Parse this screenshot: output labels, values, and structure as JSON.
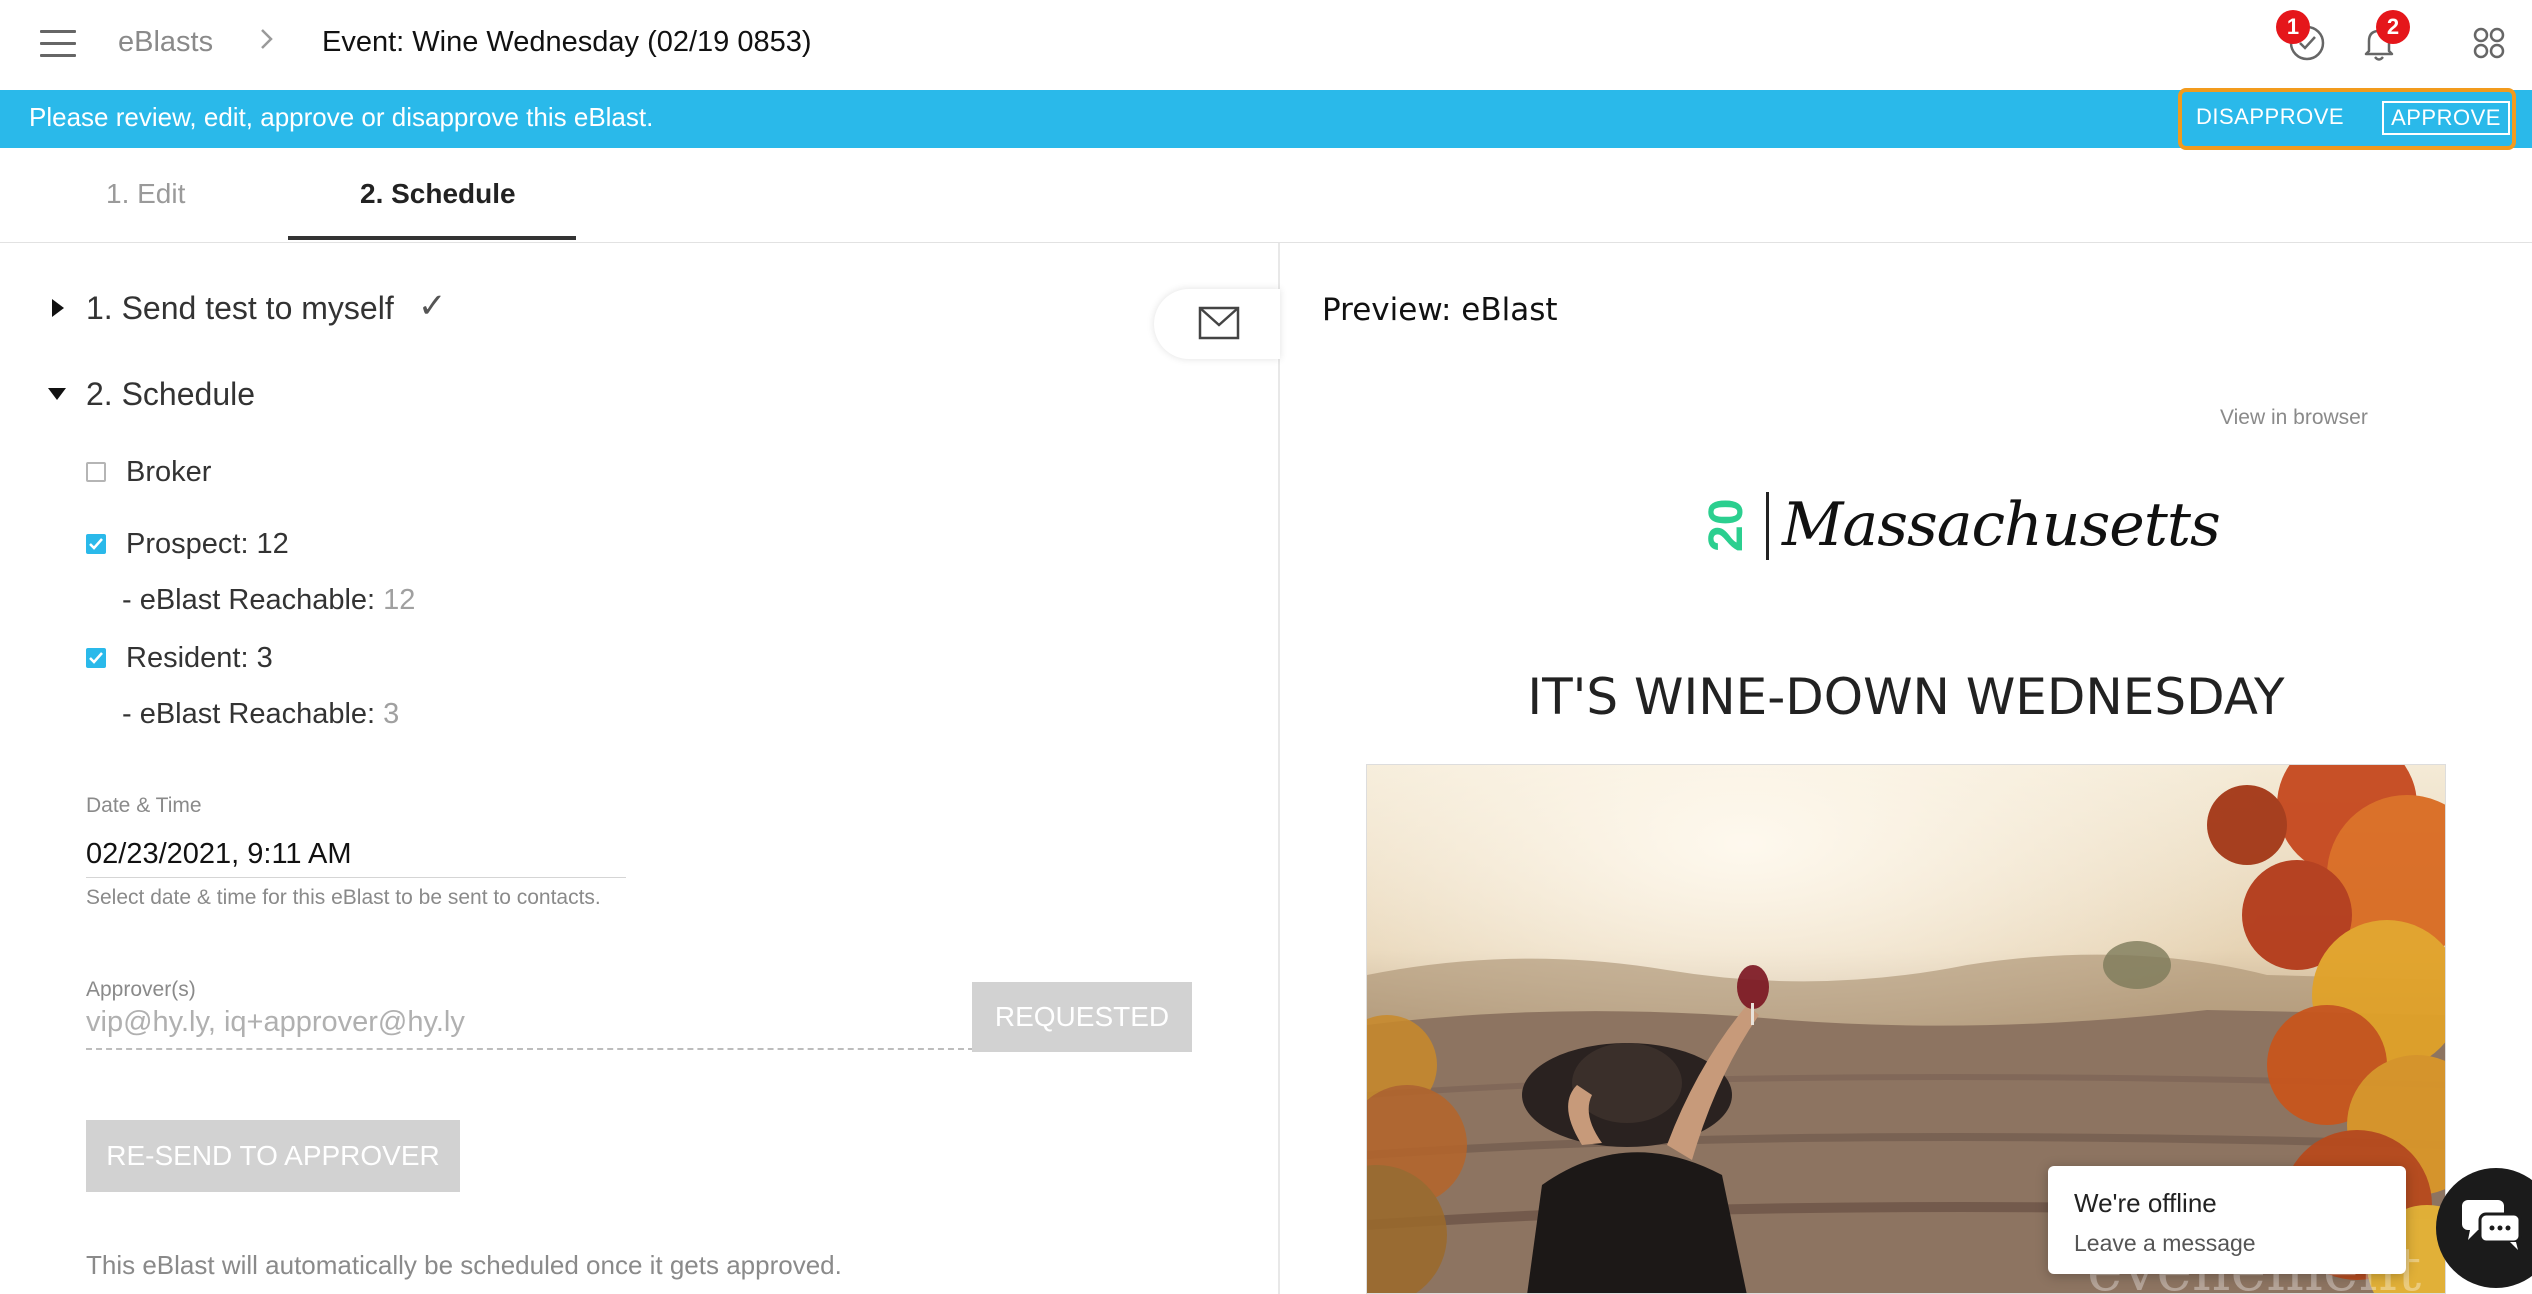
{
  "header": {
    "breadcrumb_root": "eBlasts",
    "breadcrumb_separator": ">",
    "page_title": "Event: Wine Wednesday (02/19 0853)",
    "tasks_badge": "1",
    "notifications_badge": "2"
  },
  "infobar": {
    "message": "Please review, edit, approve or disapprove this eBlast.",
    "disapprove_label": "DISAPPROVE",
    "approve_label": "APPROVE"
  },
  "tabs": [
    {
      "label": "1. Edit",
      "active": false
    },
    {
      "label": "2. Schedule",
      "active": true
    }
  ],
  "left": {
    "section1_title": "1. Send test to myself",
    "section1_done": "✓",
    "section2_title": "2. Schedule",
    "broker": {
      "label": "Broker",
      "checked": false
    },
    "prospect": {
      "label": "Prospect: 12",
      "checked": true,
      "reachable_label": "- eBlast Reachable:",
      "reachable_value": "12"
    },
    "resident": {
      "label": "Resident: 3",
      "checked": true,
      "reachable_label": "- eBlast Reachable:",
      "reachable_value": "3"
    },
    "datetime_label": "Date & Time",
    "datetime_value": "02/23/2021, 9:11 AM",
    "datetime_hint": "Select date & time for this eBlast to be sent to contacts.",
    "approvers_label": "Approver(s)",
    "approvers_value": "vip@hy.ly, iq+approver@hy.ly",
    "requested_label": "REQUESTED",
    "resend_label": "RE-SEND TO APPROVER",
    "footer_note": "This eBlast will automatically be scheduled once it gets approved."
  },
  "preview": {
    "title": "Preview: eBlast",
    "view_in_browser": "View in browser",
    "logo_number": "20",
    "logo_text": "Massachusetts",
    "headline": "IT'S WINE-DOWN WEDNESDAY",
    "hero_watermark": "événement"
  },
  "chat": {
    "title": "We're offline",
    "subtitle": "Leave a message"
  },
  "colors": {
    "accent": "#2ab9ea",
    "highlight_border": "#f29b1d",
    "badge": "#e5161b",
    "logo_green": "#2bcf8f"
  }
}
